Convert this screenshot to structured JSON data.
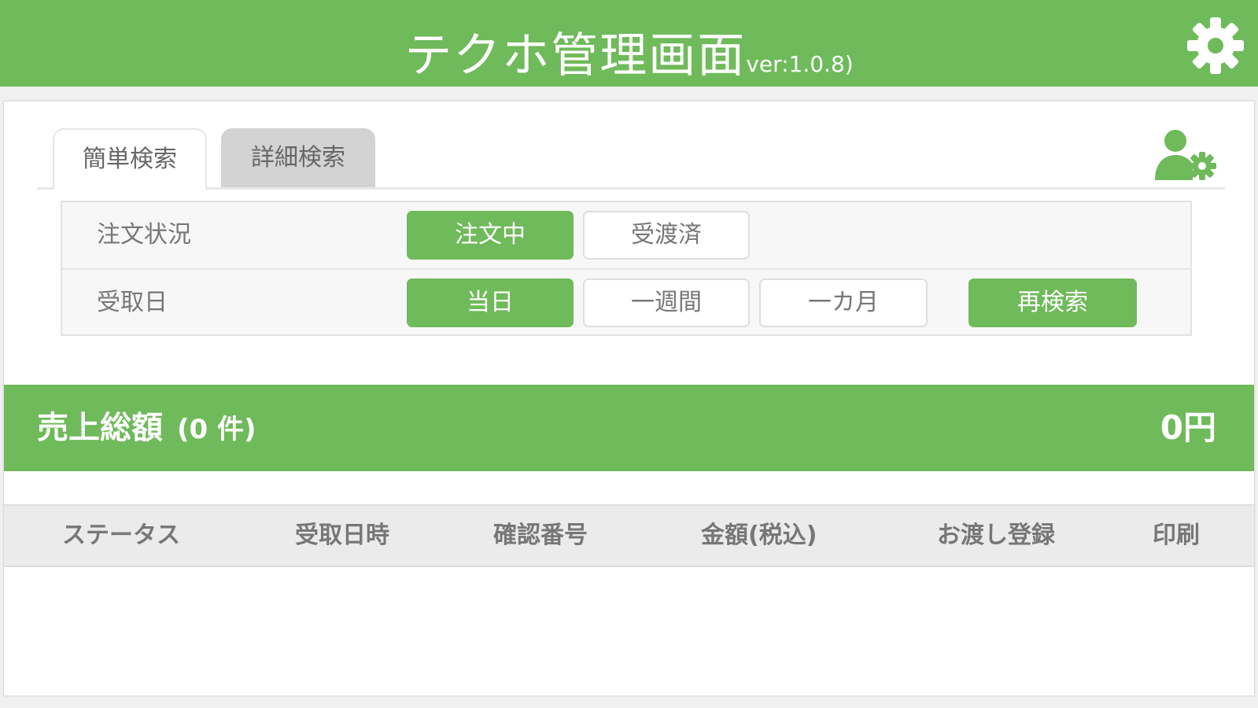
{
  "header": {
    "title": "テクホ管理画面",
    "version": "ver:1.0.8)",
    "settings_icon": "gear-icon"
  },
  "tabs": [
    {
      "label": "簡単検索",
      "active": true
    },
    {
      "label": "詳細検索",
      "active": false
    }
  ],
  "user_settings_icon": "user-gear-icon",
  "filters": {
    "order_status": {
      "label": "注文状況",
      "options": [
        {
          "label": "注文中",
          "selected": true
        },
        {
          "label": "受渡済",
          "selected": false
        }
      ]
    },
    "pickup_date": {
      "label": "受取日",
      "options": [
        {
          "label": "当日",
          "selected": true
        },
        {
          "label": "一週間",
          "selected": false
        },
        {
          "label": "一カ月",
          "selected": false
        }
      ]
    },
    "research_button": "再検索"
  },
  "sales": {
    "label": "売上総額",
    "count": "(0 件)",
    "amount": "0円"
  },
  "table": {
    "columns": [
      "ステータス",
      "受取日時",
      "確認番号",
      "金額(税込)",
      "お渡し登録",
      "印刷"
    ],
    "rows": []
  },
  "colors": {
    "accent": "#6fba5a",
    "text_muted": "#777777",
    "tab_inactive": "#d3d3d3"
  }
}
